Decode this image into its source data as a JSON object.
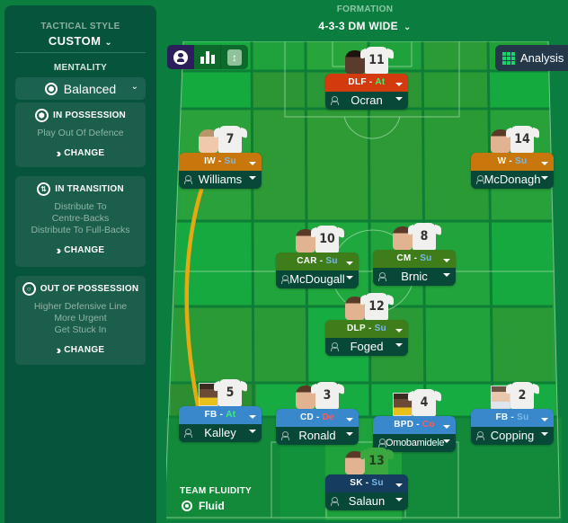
{
  "sidebar": {
    "tactical_style_label": "TACTICAL STYLE",
    "tactical_style_value": "CUSTOM",
    "mentality_label": "MENTALITY",
    "mentality_value": "Balanced",
    "cards": [
      {
        "title": "IN POSSESSION",
        "icon": "football-icon",
        "lines": [
          "Play Out Of Defence"
        ],
        "change_label": "CHANGE"
      },
      {
        "title": "IN TRANSITION",
        "icon": "transition-icon",
        "lines": [
          "Distribute To",
          "Centre-Backs",
          "Distribute To Full-Backs"
        ],
        "change_label": "CHANGE"
      },
      {
        "title": "OUT OF POSSESSION",
        "icon": "shield-ball-icon",
        "lines": [
          "Higher Defensive Line",
          "More Urgent",
          "Get Stuck In"
        ],
        "change_label": "CHANGE"
      }
    ]
  },
  "formation": {
    "label": "FORMATION",
    "value": "4-3-3 DM WIDE"
  },
  "toolbar": {
    "buttons": [
      "profile-view",
      "stats-view",
      "instructions-view"
    ],
    "analysis_label": "Analysis"
  },
  "colors": {
    "attack_role": "#d33a0e",
    "wide_role": "#c8770c",
    "midfield_role": "#3e7d1a",
    "defence_role": "#3a88cc",
    "goalkeeper_role": "#163c60",
    "duty_support": "#7ab8e8",
    "duty_attack": "#3ef07a",
    "duty_defend": "#ff5a5a",
    "run_arrow": "#e8a812"
  },
  "players": [
    {
      "id": "st",
      "number": "11",
      "role": "DLF",
      "duty": "At",
      "duty_class": "at",
      "name": "Ocran",
      "band": "r-red"
    },
    {
      "id": "lw",
      "number": "7",
      "role": "IW",
      "duty": "Su",
      "duty_class": "su",
      "name": "Williams",
      "band": "r-orange"
    },
    {
      "id": "rw",
      "number": "14",
      "role": "W",
      "duty": "Su",
      "duty_class": "su",
      "name": "McDonagh",
      "band": "r-orange"
    },
    {
      "id": "lcm",
      "number": "10",
      "role": "CAR",
      "duty": "Su",
      "duty_class": "su",
      "name": "McDougall",
      "band": "r-mid"
    },
    {
      "id": "rcm",
      "number": "8",
      "role": "CM",
      "duty": "Su",
      "duty_class": "su",
      "name": "Brnic",
      "band": "r-mid"
    },
    {
      "id": "dm",
      "number": "12",
      "role": "DLP",
      "duty": "Su",
      "duty_class": "su",
      "name": "Foged",
      "band": "r-mid"
    },
    {
      "id": "lb",
      "number": "5",
      "role": "FB",
      "duty": "At",
      "duty_class": "at",
      "name": "Kalley",
      "band": "r-blue"
    },
    {
      "id": "lcb",
      "number": "3",
      "role": "CD",
      "duty": "De",
      "duty_class": "de",
      "name": "Ronald",
      "band": "r-blue"
    },
    {
      "id": "rcb",
      "number": "4",
      "role": "BPD",
      "duty": "Co",
      "duty_class": "co",
      "name": "Omobamidele",
      "band": "r-blue"
    },
    {
      "id": "rb",
      "number": "2",
      "role": "FB",
      "duty": "Su",
      "duty_class": "su",
      "name": "Copping",
      "band": "r-blue"
    },
    {
      "id": "gk",
      "number": "13",
      "role": "SK",
      "duty": "Su",
      "duty_class": "su",
      "name": "Salaun",
      "band": "r-navy"
    }
  ],
  "team_fluidity": {
    "label": "TEAM FLUIDITY",
    "value": "Fluid"
  }
}
